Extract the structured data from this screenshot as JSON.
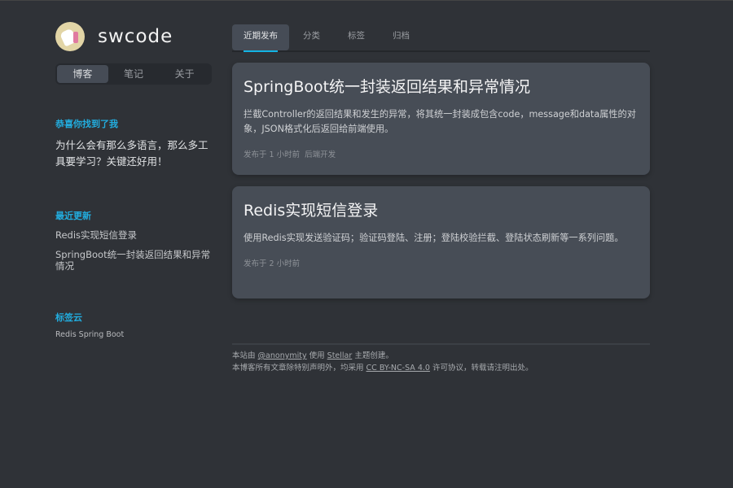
{
  "site": {
    "title": "swcode"
  },
  "nav": [
    "博客",
    "笔记",
    "关于"
  ],
  "widgets": {
    "welcome": {
      "title": "恭喜你找到了我",
      "text": "为什么会有那么多语言，那么多工具要学习？关键还好用！"
    },
    "recent": {
      "title": "最近更新",
      "items": [
        "Redis实现短信登录",
        "SpringBoot统一封装返回结果和异常情况"
      ]
    },
    "tags": {
      "title": "标签云",
      "items": [
        "Redis",
        "Spring Boot"
      ]
    }
  },
  "tabs": [
    "近期发布",
    "分类",
    "标签",
    "归档"
  ],
  "posts": [
    {
      "title": "SpringBoot统一封装返回结果和异常情况",
      "excerpt": "拦截Controller的返回结果和发生的异常，将其统一封装成包含code，message和data属性的对象，JSON格式化后返回给前端使用。",
      "meta": "发布于 1 小时前",
      "category": "后端开发"
    },
    {
      "title": "Redis实现短信登录",
      "excerpt": "使用Redis实现发送验证码；验证码登陆、注册；登陆校验拦截、登陆状态刷新等一系列问题。",
      "meta": "发布于 2 小时前"
    }
  ],
  "footer": {
    "l1a": "本站由",
    "author": "@anonymity",
    "l1b": "使用",
    "theme": "Stellar",
    "l1c": "主题创建。",
    "l2a": "本博客所有文章除特别声明外，均采用",
    "license": "CC BY-NC-SA 4.0",
    "l2b": "许可协议，转载请注明出处。"
  },
  "colors": {
    "accent": "#13b4e4",
    "card": "#474d56",
    "bg": "#2f3237"
  }
}
